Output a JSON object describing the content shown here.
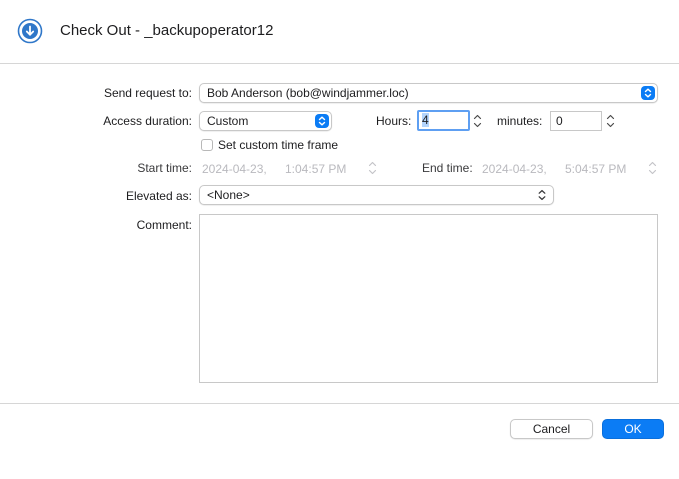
{
  "window": {
    "title": "Check Out - _backupoperator12",
    "icon": "download-circle-icon"
  },
  "form": {
    "send_request_label": "Send request to:",
    "send_request_value": "Bob Anderson (bob@windjammer.loc)",
    "access_duration_label": "Access duration:",
    "access_duration_value": "Custom",
    "hours_label": "Hours:",
    "hours_value": "4",
    "minutes_label": "minutes:",
    "minutes_value": "0",
    "custom_time_frame_label": "Set custom time frame",
    "start_time_label": "Start time:",
    "start_date": "2024-04-23,",
    "start_clock": "1:04:57 PM",
    "end_time_label": "End time:",
    "end_date": "2024-04-23,",
    "end_clock": "5:04:57 PM",
    "elevated_as_label": "Elevated as:",
    "elevated_as_value": "<None>",
    "comment_label": "Comment:",
    "comment_value": ""
  },
  "footer": {
    "cancel_label": "Cancel",
    "ok_label": "OK"
  },
  "colors": {
    "accent": "#0b7cf5",
    "focus_ring": "#5e9ff2",
    "disabled_text": "#b9b9be"
  }
}
